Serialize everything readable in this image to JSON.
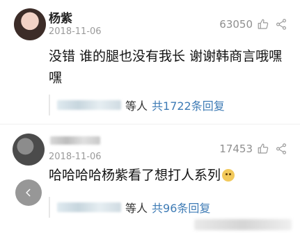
{
  "comments": [
    {
      "username": "杨紫",
      "date": "2018-11-06",
      "likes": "63050",
      "text": "没错 谁的腿也没有我长 谢谢韩商言哦嘿嘿",
      "replies_suffix": "等人",
      "replies_link": "共1722条回复"
    },
    {
      "username": "",
      "date": "2018-11-06",
      "likes": "17453",
      "text": "哈哈哈哈杨紫看了想打人系列",
      "replies_suffix": "等人",
      "replies_link": "共96条回复"
    }
  ],
  "icons": {
    "thumb": "thumbs-up-icon",
    "share": "share-icon",
    "back": "back-chevron-icon",
    "emoji": "dog-emoji-icon"
  },
  "colors": {
    "link": "#3e7bb5",
    "muted": "#9a9a9a",
    "back_button": "#8c8c8c"
  }
}
